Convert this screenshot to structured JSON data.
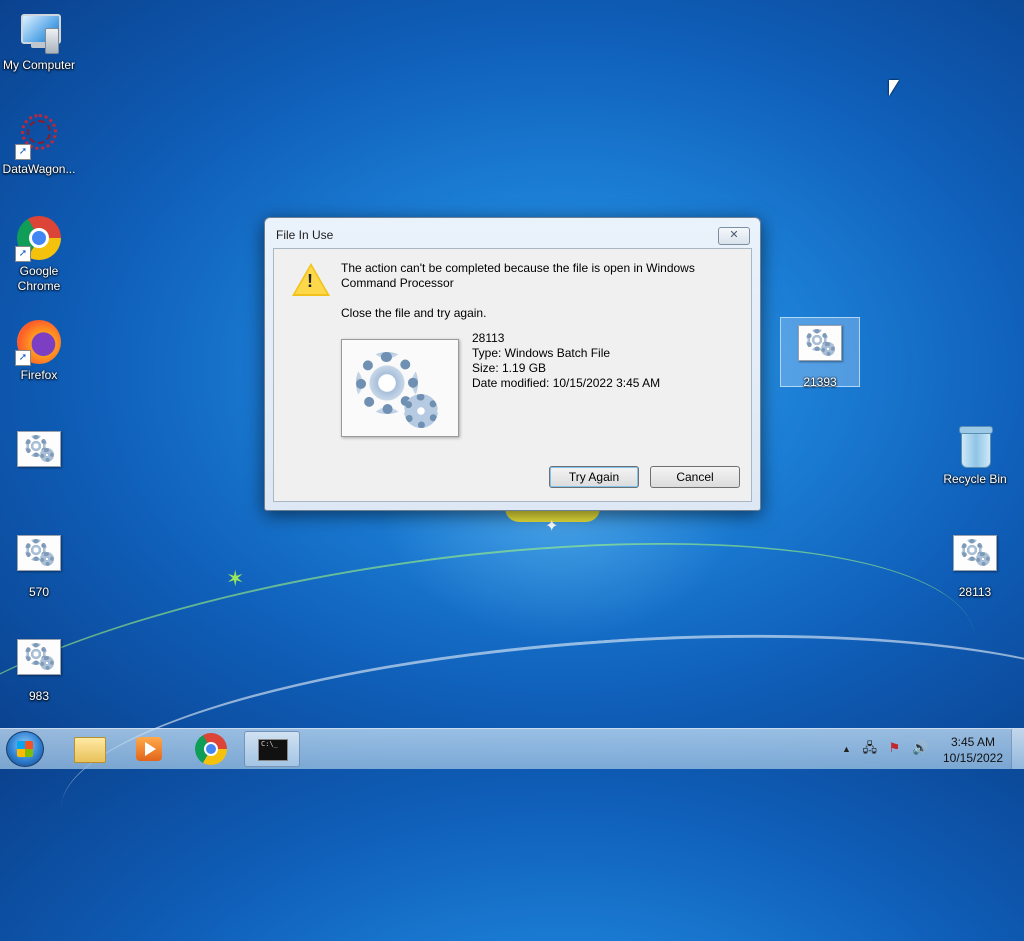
{
  "desktop": {
    "icons": [
      {
        "label": "My Computer"
      },
      {
        "label": "DataWagon..."
      },
      {
        "label": "Google Chrome"
      },
      {
        "label": "Firefox"
      },
      {
        "label": ""
      },
      {
        "label": "570"
      },
      {
        "label": "983"
      },
      {
        "label": "21393"
      },
      {
        "label": "Recycle Bin"
      },
      {
        "label": "28113"
      }
    ]
  },
  "dialog": {
    "title": "File In Use",
    "close_glyph": "✕",
    "message": "The action can't be completed because the file is open in Windows Command Processor",
    "instruction": "Close the file and try again.",
    "file": {
      "name": "28113",
      "type": "Type: Windows Batch File",
      "size": "Size: 1.19 GB",
      "date_modified": "Date modified: 10/15/2022 3:45 AM"
    },
    "buttons": {
      "try_again": "Try Again",
      "cancel": "Cancel"
    }
  },
  "taskbar": {
    "apps": [
      "explorer",
      "windows-media-player",
      "google-chrome",
      "command-prompt"
    ],
    "cmd_glyph": "C:\\_",
    "tray_icons": [
      "show-hidden-icons-arrow",
      "network-icon",
      "action-center-flag-icon",
      "volume-icon"
    ],
    "tray_glyphs": {
      "arrow": "▲",
      "network": "🖧",
      "flag": "⚑",
      "volume": "🔊"
    },
    "clock": {
      "time": "3:45 AM",
      "date": "10/15/2022"
    }
  }
}
